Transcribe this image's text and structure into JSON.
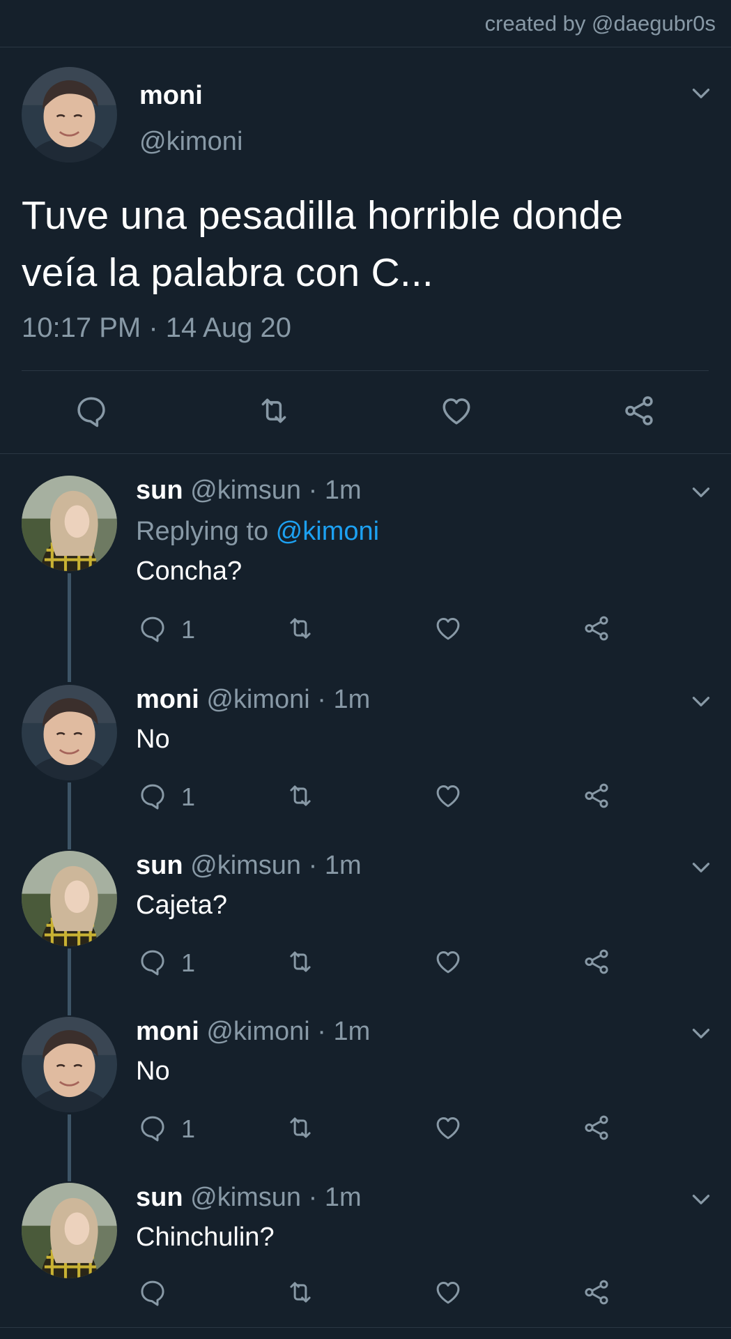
{
  "credit": "created by @daegubr0s",
  "main_tweet": {
    "name": "moni",
    "handle": "@kimoni",
    "text_line1": "Tuve una pesadilla horrible donde",
    "text_line2": "veía la palabra con C...",
    "timestamp": "10:17 PM · 14 Aug 20"
  },
  "replies": [
    {
      "name": "sun",
      "meta": "@kimsun · 1m",
      "replying_prefix": "Replying to ",
      "replying_handle": "@kimoni",
      "text": "Concha?",
      "reply_count": "1"
    },
    {
      "name": "moni",
      "meta": "@kimoni · 1m",
      "text": "No",
      "reply_count": "1"
    },
    {
      "name": "sun",
      "meta": "@kimsun · 1m",
      "text": "Cajeta?",
      "reply_count": "1"
    },
    {
      "name": "moni",
      "meta": "@kimoni · 1m",
      "text": "No",
      "reply_count": "1"
    },
    {
      "name": "sun",
      "meta": "@kimsun · 1m",
      "text": "Chinchulin?",
      "reply_count": ""
    }
  ],
  "colors": {
    "background": "#15202b",
    "secondary_text": "#8899a6",
    "link": "#1da1f2",
    "thread_line": "#3d5466"
  },
  "icons": [
    "reply-icon",
    "retweet-icon",
    "like-icon",
    "share-icon",
    "chevron-down-icon"
  ]
}
